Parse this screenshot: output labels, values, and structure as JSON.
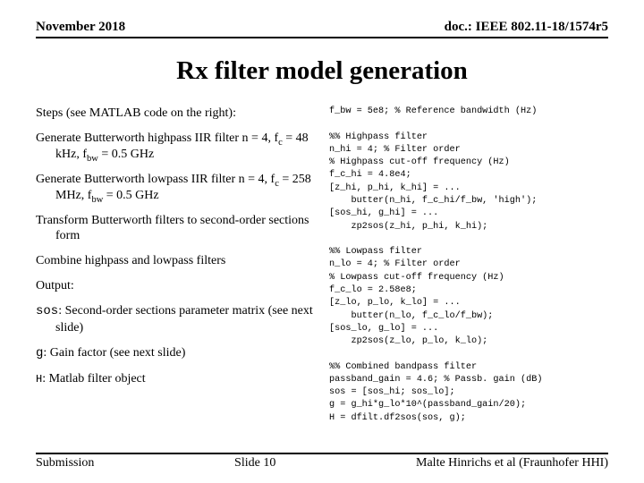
{
  "header": {
    "left": "November 2018",
    "right": "doc.: IEEE 802.11-18/1574r5"
  },
  "title": "Rx filter model generation",
  "left": {
    "p1": "Steps (see MATLAB code on the right):",
    "p2a": "Generate Butterworth highpass IIR filter n = 4, f",
    "p2b": " = 48 kHz, f",
    "p2c": " = 0.5 GHz",
    "sub_c": "c",
    "sub_bw": "bw",
    "p3a": "Generate Butterworth lowpass IIR filter n = 4, f",
    "p3b": " = 258 MHz, f",
    "p3c": " = 0.5 GHz",
    "p4": "Transform Butterworth filters to second-order sections form",
    "p5": "Combine highpass and lowpass filters",
    "p6": "Output:",
    "p7_code": "sos",
    "p7_rest": ": Second-order sections parameter matrix (see next slide)",
    "p8_code": "g",
    "p8_rest": ": Gain factor (see next slide)",
    "p9_code": "H",
    "p9_rest": ": Matlab filter object"
  },
  "code": "f_bw = 5e8; % Reference bandwidth (Hz)\n\n%% Highpass filter\nn_hi = 4; % Filter order\n% Highpass cut-off frequency (Hz)\nf_c_hi = 4.8e4;\n[z_hi, p_hi, k_hi] = ...\n    butter(n_hi, f_c_hi/f_bw, 'high');\n[sos_hi, g_hi] = ...\n    zp2sos(z_hi, p_hi, k_hi);\n\n%% Lowpass filter\nn_lo = 4; % Filter order\n% Lowpass cut-off frequency (Hz)\nf_c_lo = 2.58e8;\n[z_lo, p_lo, k_lo] = ...\n    butter(n_lo, f_c_lo/f_bw);\n[sos_lo, g_lo] = ...\n    zp2sos(z_lo, p_lo, k_lo);\n\n%% Combined bandpass filter\npassband_gain = 4.6; % Passb. gain (dB)\nsos = [sos_hi; sos_lo];\ng = g_hi*g_lo*10^(passband_gain/20);\nH = dfilt.df2sos(sos, g);",
  "footer": {
    "left": "Submission",
    "center": "Slide 10",
    "right": "Malte Hinrichs et al (Fraunhofer HHI)"
  }
}
